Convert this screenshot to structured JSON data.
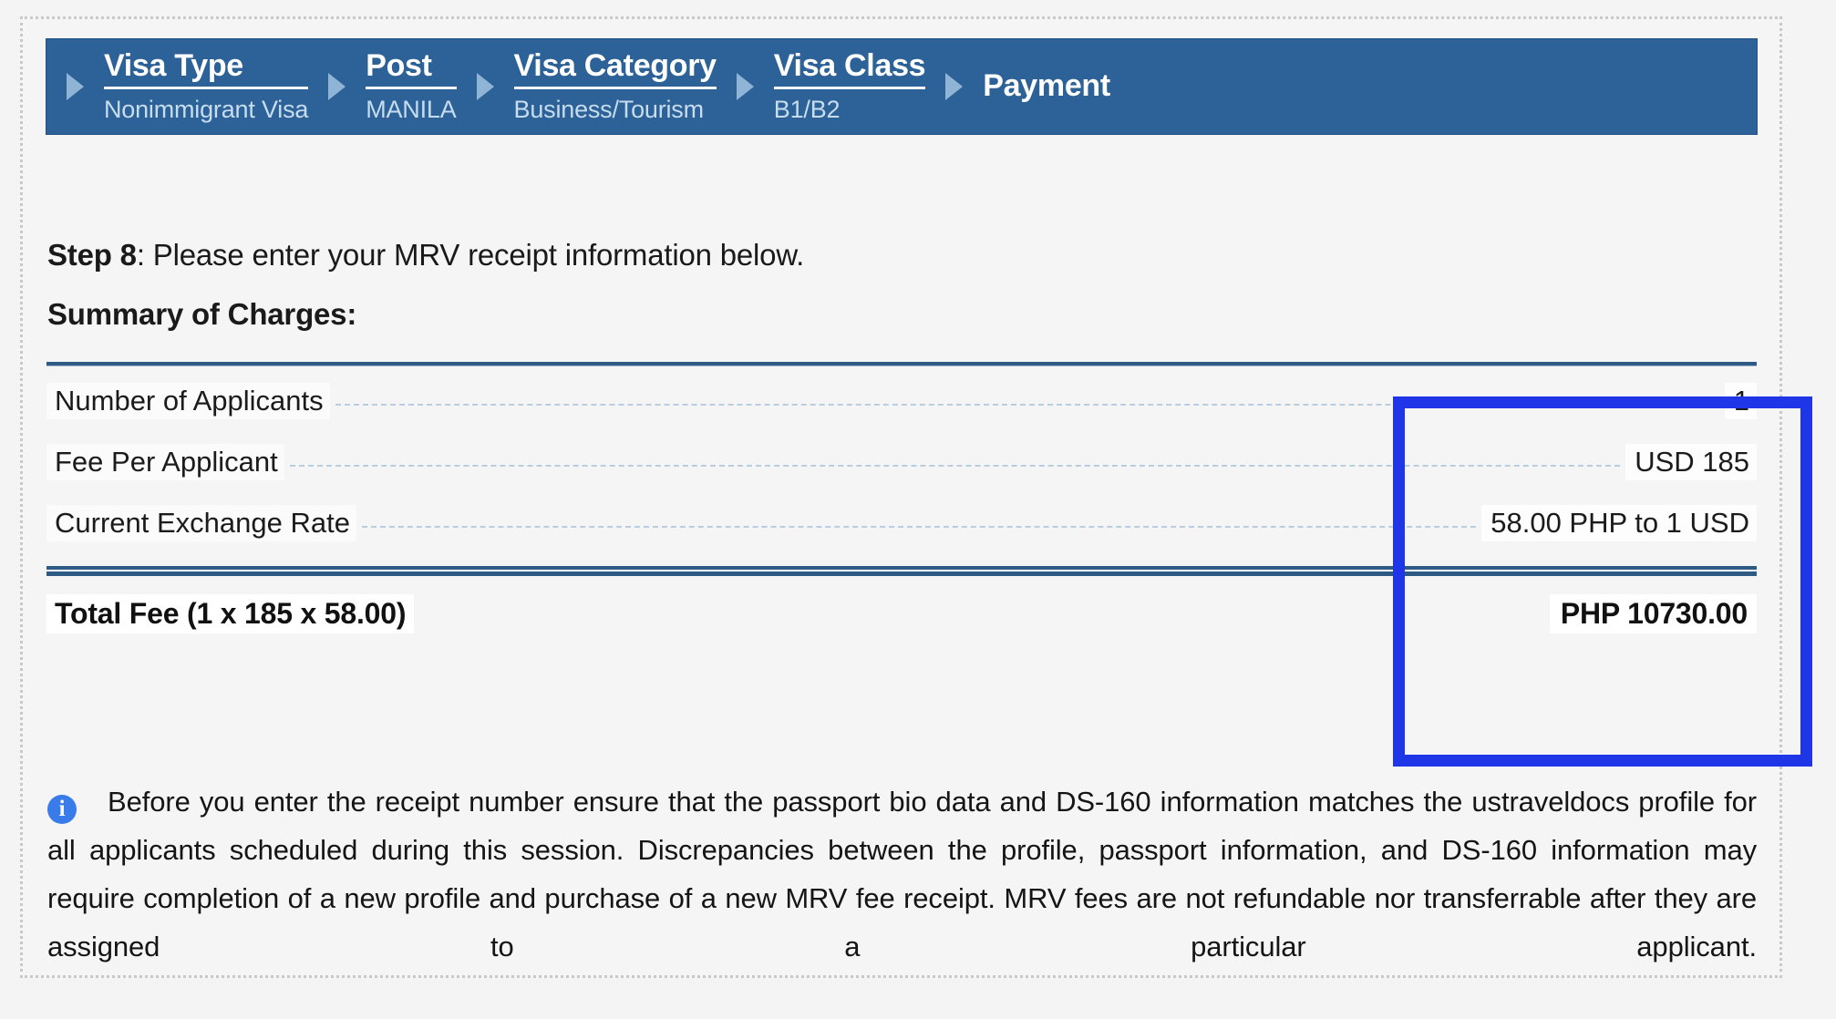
{
  "stepper": {
    "steps": [
      {
        "title": "Visa Type",
        "sub": "Nonimmigrant Visa"
      },
      {
        "title": "Post",
        "sub": "MANILA"
      },
      {
        "title": "Visa Category",
        "sub": "Business/Tourism"
      },
      {
        "title": "Visa Class",
        "sub": "B1/B2"
      },
      {
        "title": "Payment",
        "sub": ""
      }
    ]
  },
  "instruction": {
    "step_label": "Step 8",
    "text": ": Please enter your MRV receipt information below."
  },
  "summary": {
    "heading": "Summary of Charges:",
    "rows": [
      {
        "label": "Number of Applicants",
        "value": "1"
      },
      {
        "label": "Fee Per Applicant",
        "value": "USD 185"
      },
      {
        "label": "Current Exchange Rate",
        "value": "58.00 PHP to 1 USD"
      }
    ],
    "total": {
      "label": "Total Fee (1 x 185 x 58.00)",
      "value": "PHP 10730.00"
    }
  },
  "notice": {
    "icon": "info-icon",
    "text": "Before you enter the receipt number ensure that the passport bio data and DS-160 information matches the ustraveldocs profile for all applicants scheduled during this session. Discrepancies between the profile, passport information, and DS-160 information may require completion of a new profile and purchase of a new MRV fee receipt. MRV fees are not refundable nor transferrable after they are assigned to a particular applicant."
  },
  "colors": {
    "stepper_blue": "#2c6297",
    "rule_navy": "#2e5a86",
    "highlight_blue": "#1f35e8",
    "leader_blue": "#b9cde0",
    "info_blue": "#3a7bea"
  }
}
